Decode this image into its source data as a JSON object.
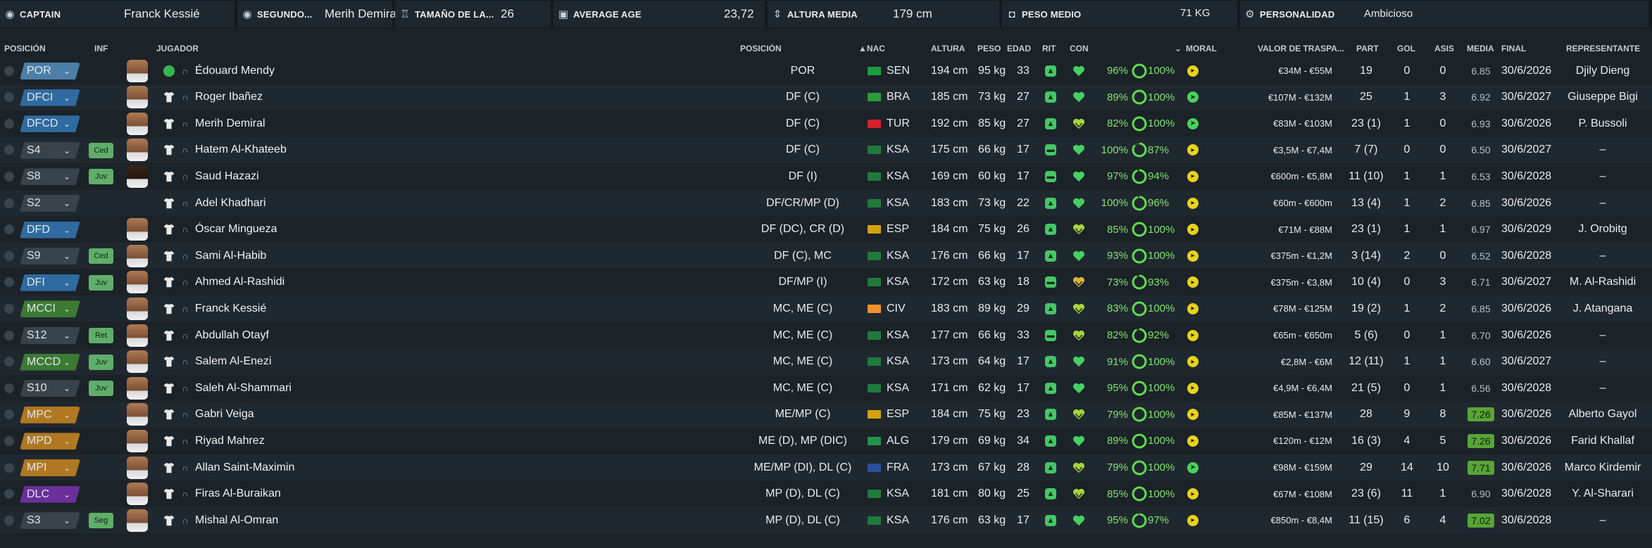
{
  "summary": [
    {
      "icon": "captain-icon",
      "label": "CAPTAIN",
      "value": "Franck Kessié"
    },
    {
      "icon": "vice-captain-icon",
      "label": "SEGUNDO...",
      "value": "Merih Demiral"
    },
    {
      "icon": "squad-size-icon",
      "label": "TAMAÑO DE LA...",
      "value": "26"
    },
    {
      "icon": "age-icon",
      "label": "AVERAGE AGE",
      "value": "23,72"
    },
    {
      "icon": "height-icon",
      "label": "ALTURA MEDIA",
      "value": "179 cm"
    },
    {
      "icon": "weight-icon",
      "label": "PESO MEDIO",
      "value": "71 KG"
    },
    {
      "icon": "personality-icon",
      "label": "PERSONALIDAD",
      "value": "Ambicioso"
    }
  ],
  "columns": {
    "posicion": "POSICIÓN",
    "inf": "INF",
    "jugador": "JUGADOR",
    "posicion2": "POSICIÓN",
    "nac": "▲NAC",
    "altura": "ALTURA",
    "peso": "PESO",
    "edad": "EDAD",
    "rit": "RIT",
    "con": "CON",
    "moral": "MORAL",
    "valor": "VALOR DE TRASPA...",
    "part": "PART",
    "gol": "GOL",
    "asis": "ASIS",
    "media": "MEDIA",
    "final": "FINAL",
    "representante": "REPRESENTANTE"
  },
  "colors": {
    "gk": "#4b7fa8",
    "def": "#2f6aa0",
    "mid": "#3c7a34",
    "att": "#b07820",
    "str": "#6a2f9a",
    "sub": "#3a434a",
    "flag_sen": "#1b9e3f",
    "flag_bra": "#2a9d3a",
    "flag_tur": "#d6202c",
    "flag_ksa": "#1f7a3c",
    "flag_esp": "#d4a20c",
    "flag_civ": "#f0932a",
    "flag_alg": "#22924a",
    "flag_fra": "#2a4fa0"
  },
  "players": [
    {
      "pos": "POR",
      "role": "gk",
      "inf": "",
      "face": "n",
      "name": "Édouard Mendy",
      "badge": true,
      "position": "POR",
      "flag": "flag_sen",
      "nat": "SEN",
      "height": "194 cm",
      "weight": "95 kg",
      "age": "33",
      "rit": "up",
      "con": "full",
      "cond": "96%",
      "sharp": "100%",
      "moral": "good",
      "value": "€34M - €55M",
      "apps": "19",
      "goals": "0",
      "assists": "0",
      "rating": "6.85",
      "hi": false,
      "end": "30/6/2026",
      "agent": "Djily Dieng"
    },
    {
      "pos": "DFCI",
      "role": "def",
      "inf": "",
      "face": "n",
      "name": "Roger Ibañez",
      "badge": false,
      "position": "DF (C)",
      "flag": "flag_bra",
      "nat": "BRA",
      "height": "185 cm",
      "weight": "73 kg",
      "age": "27",
      "rit": "up",
      "con": "full",
      "cond": "89%",
      "sharp": "100%",
      "moral": "vgood",
      "value": "€107M - €132M",
      "apps": "25",
      "goals": "1",
      "assists": "3",
      "rating": "6.92",
      "hi": false,
      "end": "30/6/2027",
      "agent": "Giuseppe Bigi"
    },
    {
      "pos": "DFCD",
      "role": "def",
      "inf": "",
      "face": "n",
      "name": "Merih Demiral",
      "badge": false,
      "position": "DF (C)",
      "flag": "flag_tur",
      "nat": "TUR",
      "height": "192 cm",
      "weight": "85 kg",
      "age": "27",
      "rit": "up",
      "con": "ok",
      "cond": "82%",
      "sharp": "100%",
      "moral": "vgood",
      "value": "€83M - €103M",
      "apps": "23 (1)",
      "goals": "1",
      "assists": "0",
      "rating": "6.93",
      "hi": false,
      "end": "30/6/2026",
      "agent": "P. Bussoli"
    },
    {
      "pos": "S4",
      "role": "sub",
      "inf": "Ced",
      "face": "n",
      "name": "Hatem Al-Khateeb",
      "badge": false,
      "position": "DF (C)",
      "flag": "flag_ksa",
      "nat": "KSA",
      "height": "175 cm",
      "weight": "66 kg",
      "age": "17",
      "rit": "flat",
      "con": "full",
      "cond": "100%",
      "sharp": "87%",
      "moral": "good",
      "value": "€3,5M - €7,4M",
      "apps": "7 (7)",
      "goals": "0",
      "assists": "0",
      "rating": "6.50",
      "hi": false,
      "end": "30/6/2027",
      "agent": "–"
    },
    {
      "pos": "S8",
      "role": "sub",
      "inf": "Juv",
      "face": "d",
      "name": "Saud Hazazi",
      "badge": false,
      "position": "DF (I)",
      "flag": "flag_ksa",
      "nat": "KSA",
      "height": "169 cm",
      "weight": "60 kg",
      "age": "17",
      "rit": "flat",
      "con": "full",
      "cond": "97%",
      "sharp": "94%",
      "moral": "good",
      "value": "€600m - €5,8M",
      "apps": "11 (10)",
      "goals": "1",
      "assists": "1",
      "rating": "6.53",
      "hi": false,
      "end": "30/6/2028",
      "agent": "–"
    },
    {
      "pos": "S2",
      "role": "sub",
      "inf": "",
      "face": "x",
      "name": "Adel Khadhari",
      "badge": false,
      "position": "DF/CR/MP (D)",
      "flag": "flag_ksa",
      "nat": "KSA",
      "height": "183 cm",
      "weight": "73 kg",
      "age": "22",
      "rit": "up",
      "con": "full",
      "cond": "100%",
      "sharp": "96%",
      "moral": "good",
      "value": "€60m - €600m",
      "apps": "13 (4)",
      "goals": "1",
      "assists": "2",
      "rating": "6.85",
      "hi": false,
      "end": "30/6/2026",
      "agent": "–"
    },
    {
      "pos": "DFD",
      "role": "def",
      "inf": "",
      "face": "n",
      "name": "Óscar Mingueza",
      "badge": false,
      "position": "DF (DC), CR (D)",
      "flag": "flag_esp",
      "nat": "ESP",
      "height": "184 cm",
      "weight": "75 kg",
      "age": "26",
      "rit": "up",
      "con": "ok",
      "cond": "85%",
      "sharp": "100%",
      "moral": "good",
      "value": "€71M - €88M",
      "apps": "23 (1)",
      "goals": "1",
      "assists": "1",
      "rating": "6.97",
      "hi": false,
      "end": "30/6/2029",
      "agent": "J. Orobitg"
    },
    {
      "pos": "S9",
      "role": "sub",
      "inf": "Ced",
      "face": "n",
      "name": "Sami Al-Habib",
      "badge": false,
      "position": "DF (C), MC",
      "flag": "flag_ksa",
      "nat": "KSA",
      "height": "176 cm",
      "weight": "66 kg",
      "age": "17",
      "rit": "up",
      "con": "full",
      "cond": "93%",
      "sharp": "100%",
      "moral": "good",
      "value": "€375m - €1,2M",
      "apps": "3 (14)",
      "goals": "2",
      "assists": "0",
      "rating": "6.52",
      "hi": false,
      "end": "30/6/2028",
      "agent": "–"
    },
    {
      "pos": "DFI",
      "role": "def",
      "inf": "Juv",
      "face": "n",
      "name": "Ahmed Al-Rashidi",
      "badge": false,
      "position": "DF/MP (I)",
      "flag": "flag_ksa",
      "nat": "KSA",
      "height": "172 cm",
      "weight": "63 kg",
      "age": "18",
      "rit": "flat",
      "con": "low",
      "cond": "73%",
      "sharp": "93%",
      "moral": "good",
      "value": "€375m - €3,8M",
      "apps": "10 (4)",
      "goals": "0",
      "assists": "3",
      "rating": "6.71",
      "hi": false,
      "end": "30/6/2027",
      "agent": "M. Al-Rashidi"
    },
    {
      "pos": "MCCI",
      "role": "mid",
      "inf": "",
      "face": "n",
      "name": "Franck Kessié",
      "badge": false,
      "position": "MC, ME (C)",
      "flag": "flag_civ",
      "nat": "CIV",
      "height": "183 cm",
      "weight": "89 kg",
      "age": "29",
      "rit": "up",
      "con": "ok",
      "cond": "83%",
      "sharp": "100%",
      "moral": "good",
      "value": "€78M - €125M",
      "apps": "19 (2)",
      "goals": "1",
      "assists": "2",
      "rating": "6.85",
      "hi": false,
      "end": "30/6/2026",
      "agent": "J. Atangana"
    },
    {
      "pos": "S12",
      "role": "sub",
      "inf": "Ret",
      "face": "n",
      "name": "Abdullah Otayf",
      "badge": false,
      "position": "MC, ME (C)",
      "flag": "flag_ksa",
      "nat": "KSA",
      "height": "177 cm",
      "weight": "66 kg",
      "age": "33",
      "rit": "flat",
      "con": "ok",
      "cond": "82%",
      "sharp": "92%",
      "moral": "good",
      "value": "€65m - €650m",
      "apps": "5 (6)",
      "goals": "0",
      "assists": "1",
      "rating": "6.70",
      "hi": false,
      "end": "30/6/2026",
      "agent": "–"
    },
    {
      "pos": "MCCD",
      "role": "mid",
      "inf": "Juv",
      "face": "n",
      "name": "Salem Al-Enezi",
      "badge": false,
      "position": "MC, ME (C)",
      "flag": "flag_ksa",
      "nat": "KSA",
      "height": "173 cm",
      "weight": "64 kg",
      "age": "17",
      "rit": "up",
      "con": "full",
      "cond": "91%",
      "sharp": "100%",
      "moral": "good",
      "value": "€2,8M - €6M",
      "apps": "12 (11)",
      "goals": "1",
      "assists": "1",
      "rating": "6.60",
      "hi": false,
      "end": "30/6/2027",
      "agent": "–"
    },
    {
      "pos": "S10",
      "role": "sub",
      "inf": "Juv",
      "face": "n",
      "name": "Saleh Al-Shammari",
      "badge": false,
      "position": "MC, ME (C)",
      "flag": "flag_ksa",
      "nat": "KSA",
      "height": "171 cm",
      "weight": "62 kg",
      "age": "17",
      "rit": "up",
      "con": "full",
      "cond": "95%",
      "sharp": "100%",
      "moral": "good",
      "value": "€4,9M - €6,4M",
      "apps": "21 (5)",
      "goals": "0",
      "assists": "1",
      "rating": "6.56",
      "hi": false,
      "end": "30/6/2028",
      "agent": "–"
    },
    {
      "pos": "MPC",
      "role": "att",
      "inf": "",
      "face": "n",
      "name": "Gabri Veiga",
      "badge": false,
      "position": "ME/MP (C)",
      "flag": "flag_esp",
      "nat": "ESP",
      "height": "184 cm",
      "weight": "75 kg",
      "age": "23",
      "rit": "up",
      "con": "ok",
      "cond": "79%",
      "sharp": "100%",
      "moral": "good",
      "value": "€85M - €137M",
      "apps": "28",
      "goals": "9",
      "assists": "8",
      "rating": "7.26",
      "hi": true,
      "end": "30/6/2026",
      "agent": "Alberto Gayol"
    },
    {
      "pos": "MPD",
      "role": "att",
      "inf": "",
      "face": "n",
      "name": "Riyad Mahrez",
      "badge": false,
      "position": "ME (D), MP (DIC)",
      "flag": "flag_alg",
      "nat": "ALG",
      "height": "179 cm",
      "weight": "69 kg",
      "age": "34",
      "rit": "up",
      "con": "full",
      "cond": "89%",
      "sharp": "100%",
      "moral": "good",
      "value": "€120m - €12M",
      "apps": "16 (3)",
      "goals": "4",
      "assists": "5",
      "rating": "7.26",
      "hi": true,
      "end": "30/6/2026",
      "agent": "Farid Khallaf"
    },
    {
      "pos": "MPI",
      "role": "att",
      "inf": "",
      "face": "n",
      "name": "Allan Saint-Maximin",
      "badge": false,
      "position": "ME/MP (DI), DL (C)",
      "flag": "flag_fra",
      "nat": "FRA",
      "height": "173 cm",
      "weight": "67 kg",
      "age": "28",
      "rit": "up",
      "con": "ok",
      "cond": "79%",
      "sharp": "100%",
      "moral": "vgood",
      "value": "€98M - €159M",
      "apps": "29",
      "goals": "14",
      "assists": "10",
      "rating": "7.71",
      "hi": true,
      "end": "30/6/2026",
      "agent": "Marco Kirdemir"
    },
    {
      "pos": "DLC",
      "role": "str",
      "inf": "",
      "face": "n",
      "name": "Firas Al-Buraikan",
      "badge": false,
      "position": "MP (D), DL (C)",
      "flag": "flag_ksa",
      "nat": "KSA",
      "height": "181 cm",
      "weight": "80 kg",
      "age": "25",
      "rit": "up",
      "con": "ok",
      "cond": "85%",
      "sharp": "100%",
      "moral": "good",
      "value": "€67M - €108M",
      "apps": "23 (6)",
      "goals": "11",
      "assists": "1",
      "rating": "6.90",
      "hi": false,
      "end": "30/6/2028",
      "agent": "Y. Al-Sharari"
    },
    {
      "pos": "S3",
      "role": "sub",
      "inf": "Seg",
      "face": "n",
      "name": "Mishal Al-Omran",
      "badge": false,
      "position": "MP (D), DL (C)",
      "flag": "flag_ksa",
      "nat": "KSA",
      "height": "176 cm",
      "weight": "63 kg",
      "age": "17",
      "rit": "up",
      "con": "full",
      "cond": "95%",
      "sharp": "97%",
      "moral": "good",
      "value": "€850m - €8,4M",
      "apps": "11 (15)",
      "goals": "6",
      "assists": "4",
      "rating": "7.02",
      "hi": true,
      "end": "30/6/2028",
      "agent": "–"
    }
  ]
}
